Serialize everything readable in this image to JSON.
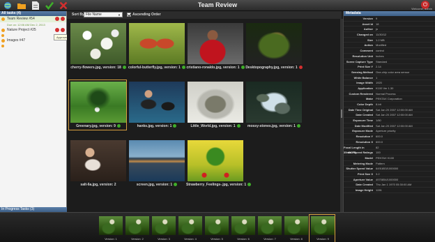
{
  "window": {
    "title": "Team Review",
    "welcome": "Welcome, admin"
  },
  "icons": {
    "app": "globe-icon",
    "open": "folder-icon",
    "save": "document-icon",
    "approve": "check-icon",
    "reject": "x-icon",
    "logout": "power-icon"
  },
  "colors": {
    "approve": "#3fae2a",
    "reject": "#d32f2f",
    "selection": "#d8a040",
    "header": "#4a6e98"
  },
  "left": {
    "all_tasks": "All tasks (4)",
    "tasks": [
      {
        "label": "Team Review #54",
        "sub": "Due on: 12:06 AM Dec 2, 2013"
      },
      {
        "label": "Nature Project #25",
        "sub": ""
      },
      {
        "label": "Images #47",
        "sub": ""
      }
    ],
    "tooltip": "Approve the selected item",
    "in_progress": "In Progress Tasks (3)"
  },
  "sort": {
    "label": "Sort By:",
    "value": "File Name",
    "ascending_label": "Ascending Order"
  },
  "grid": [
    {
      "caption": "cherry-flowers.jpg, version: 18",
      "status": "approved",
      "thumb": "t-cherry"
    },
    {
      "caption": "colorful-butterfly.jpg, version: 1",
      "status": "approved",
      "thumb": "t-butterfly"
    },
    {
      "caption": "cristiano-ronaldo.jpg, version: 1",
      "status": "approved",
      "thumb": "t-cristiano"
    },
    {
      "caption": "Desktopography.jpg, version: 1",
      "status": "rejected",
      "thumb": "t-desk"
    },
    {
      "caption": "Greenary.jpg, version: 9",
      "status": "approved",
      "thumb": "t-green"
    },
    {
      "caption": "hanks.jpg, version: 1",
      "status": "approved",
      "thumb": "t-hanks"
    },
    {
      "caption": "Little_World.jpg, version: 1",
      "status": "approved",
      "thumb": "t-little"
    },
    {
      "caption": "mossy-stones.jpg, version: 1",
      "status": "approved",
      "thumb": "t-mossy"
    },
    {
      "caption": "salt-6a.jpg, version: 2",
      "status": "",
      "thumb": "t-salt"
    },
    {
      "caption": "screen.jpg, version: 1",
      "status": "approved",
      "thumb": "t-screen"
    },
    {
      "caption": "Strawberry_Feelings-.jpg, version: 1",
      "status": "approved",
      "thumb": "t-straw"
    }
  ],
  "metadata": {
    "header": "Metadata",
    "rows": [
      [
        "Version",
        "9"
      ],
      [
        "Asset Id",
        "18"
      ],
      [
        "Author",
        "jo"
      ],
      [
        "Changed on",
        "11/30/12"
      ],
      [
        "Size",
        "1.2 MB"
      ],
      [
        "Action",
        "Modified"
      ],
      [
        "Comment",
        "control"
      ],
      [
        "Resolution Unit",
        "inches"
      ],
      [
        "Scene Capture Type",
        "Standard"
      ],
      [
        "Print Size Y",
        "2.14"
      ],
      [
        "Sensing Method",
        "One-chip color area sensor"
      ],
      [
        "White Balance",
        "1"
      ],
      [
        "Image Width",
        "1920"
      ],
      [
        "Application",
        "K100 Ver 1.30"
      ],
      [
        "Custom Rendered",
        "Normal Process"
      ],
      [
        "Make",
        "PENTAX Corporation"
      ],
      [
        "Color Depth",
        "8-bit"
      ],
      [
        "Date Time Original",
        "Sat Jan 20 2007 12:00:00 AM"
      ],
      [
        "Date Created",
        "Sat Jan 20 2007 12:00:00 AM"
      ],
      [
        "Exposure Time",
        "1/80"
      ],
      [
        "Date Modified",
        "Sat Jan 20 2007 12:00:00 AM"
      ],
      [
        "Exposure Mode",
        "Aperture priority"
      ],
      [
        "Resolution Y",
        "600.0"
      ],
      [
        "Resolution X",
        "600.0"
      ],
      [
        "Focal Length in 35mm Fil",
        "82"
      ],
      [
        "ISO Speed Ratings",
        "100"
      ],
      [
        "Model",
        "PENTAX K100"
      ],
      [
        "Metering Mode",
        "Pattern"
      ],
      [
        "Shutter Speed Value",
        "6491853/1000000"
      ],
      [
        "Print Size X",
        "3.2"
      ],
      [
        "Aperture Value",
        "4970854/1000000"
      ],
      [
        "Date Created",
        "Thu Jan 1 1970 05:30:00 AM"
      ],
      [
        "Image Height",
        "1281"
      ]
    ]
  },
  "versions": [
    "Version: 1",
    "Version: 2",
    "Version: 3",
    "Version: 4",
    "Version: 5",
    "Version: 6",
    "Version: 7",
    "Version: 8",
    "Version: 9"
  ]
}
